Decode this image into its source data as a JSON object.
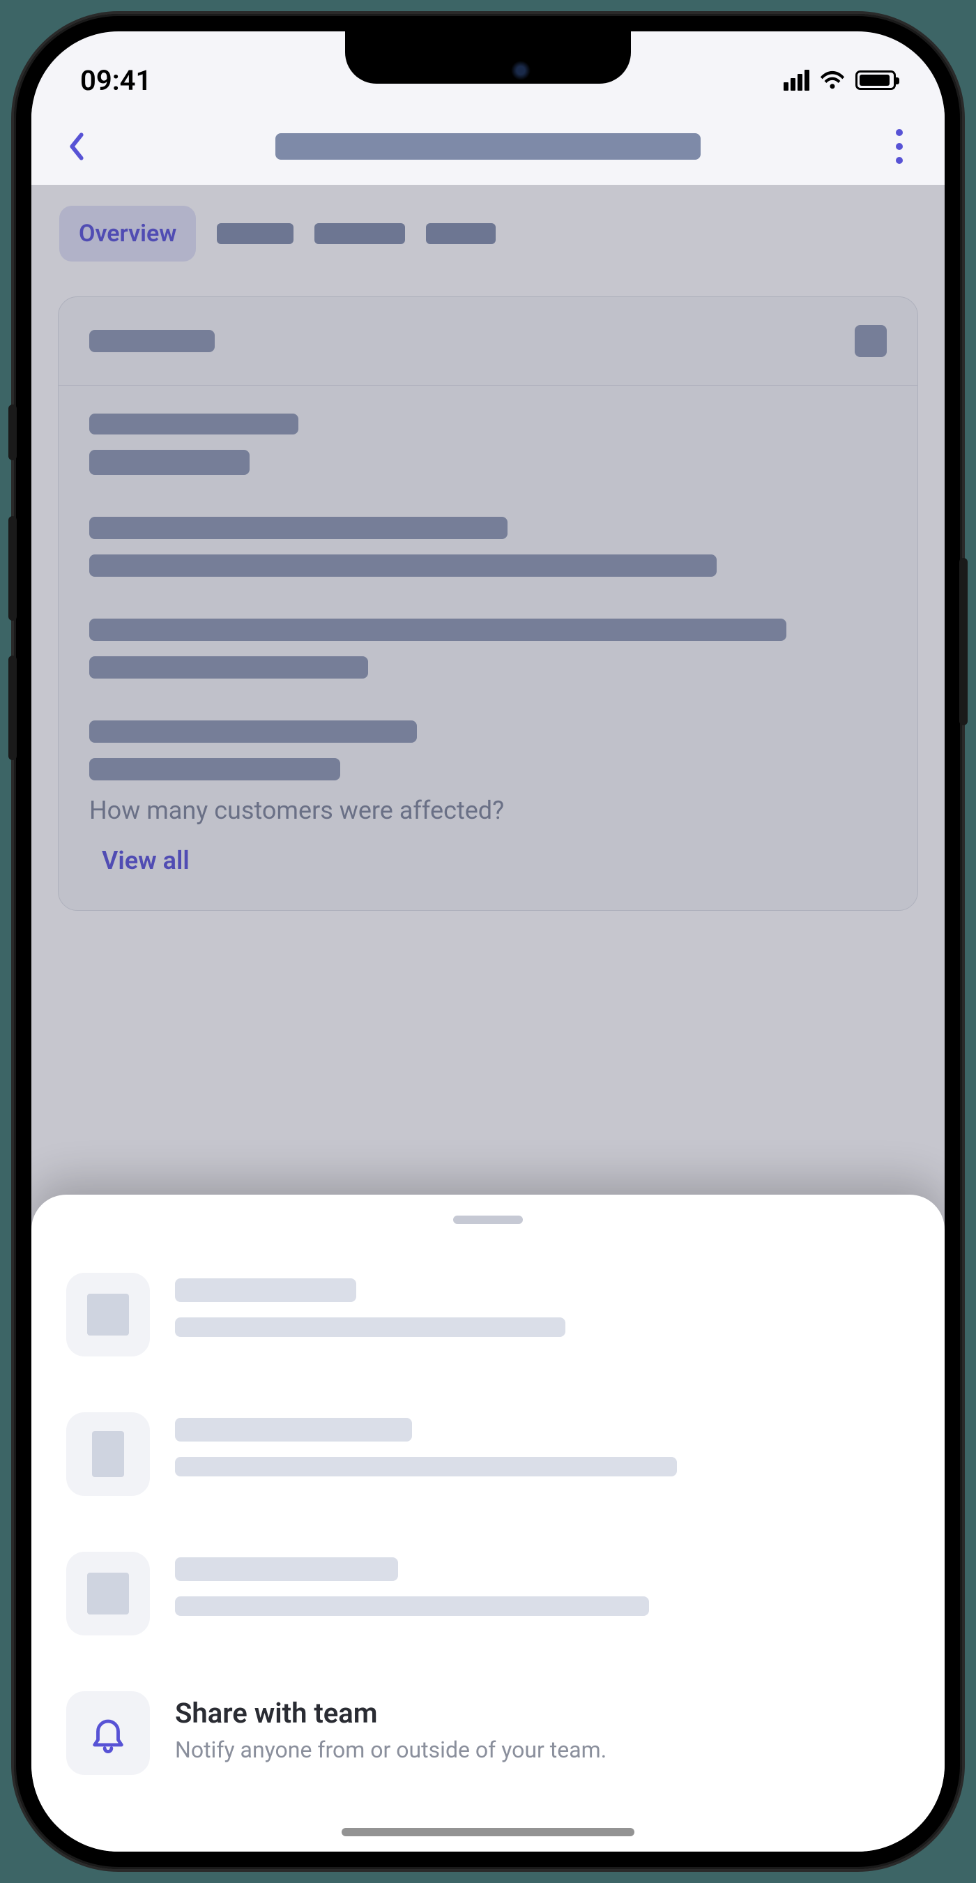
{
  "status": {
    "time": "09:41"
  },
  "tabs": {
    "active": "Overview"
  },
  "card": {
    "question": "How many customers were affected?",
    "viewAllLabel": "View all"
  },
  "sheet": {
    "share": {
      "title": "Share with team",
      "subtitle": "Notify anyone from or outside of your team."
    }
  }
}
